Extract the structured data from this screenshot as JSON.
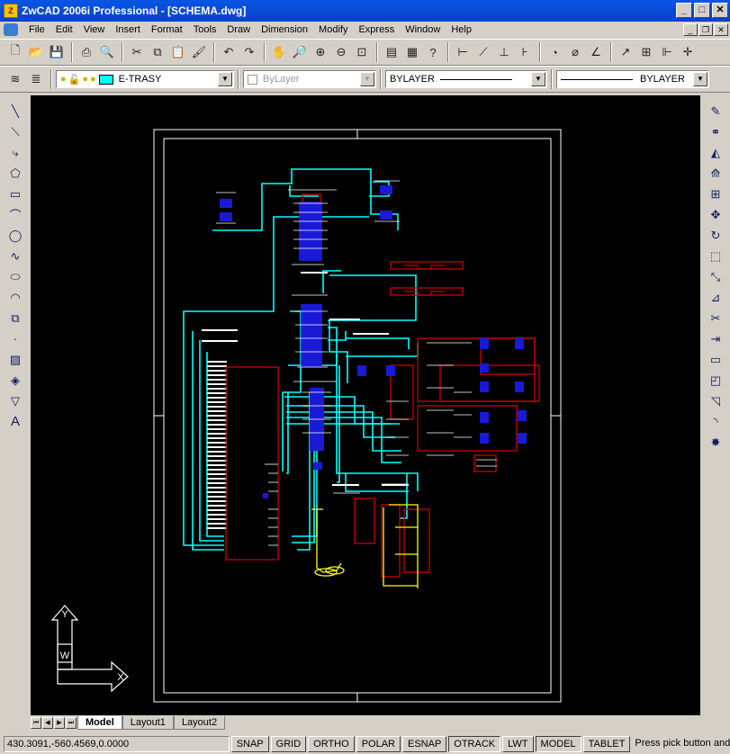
{
  "window": {
    "title": "ZwCAD 2006i Professional - [SCHEMA.dwg]"
  },
  "menu": [
    "File",
    "Edit",
    "View",
    "Insert",
    "Format",
    "Tools",
    "Draw",
    "Dimension",
    "Modify",
    "Express",
    "Window",
    "Help"
  ],
  "layers": {
    "current": "E-TRASY",
    "color_name": "ByLayer",
    "linetype": "BYLAYER",
    "lineweight": "BYLAYER",
    "layer_color": "#00ffff"
  },
  "tabs": [
    "Model",
    "Layout1",
    "Layout2"
  ],
  "status": {
    "coords": "430.3091,-560.4569,0.0000",
    "buttons": [
      "SNAP",
      "GRID",
      "ORTHO",
      "POLAR",
      "ESNAP",
      "OTRACK",
      "LWT",
      "MODEL",
      "TABLET"
    ],
    "prompt": "Press pick button and"
  },
  "ucs": {
    "y_label": "Y",
    "x_label": "X",
    "w_label": "W"
  },
  "colors": {
    "canvas": "#000000",
    "wire": "#00ffff",
    "component": "#cc0000",
    "highlight": "#ffff00",
    "title_bar": "#0a55e6"
  }
}
